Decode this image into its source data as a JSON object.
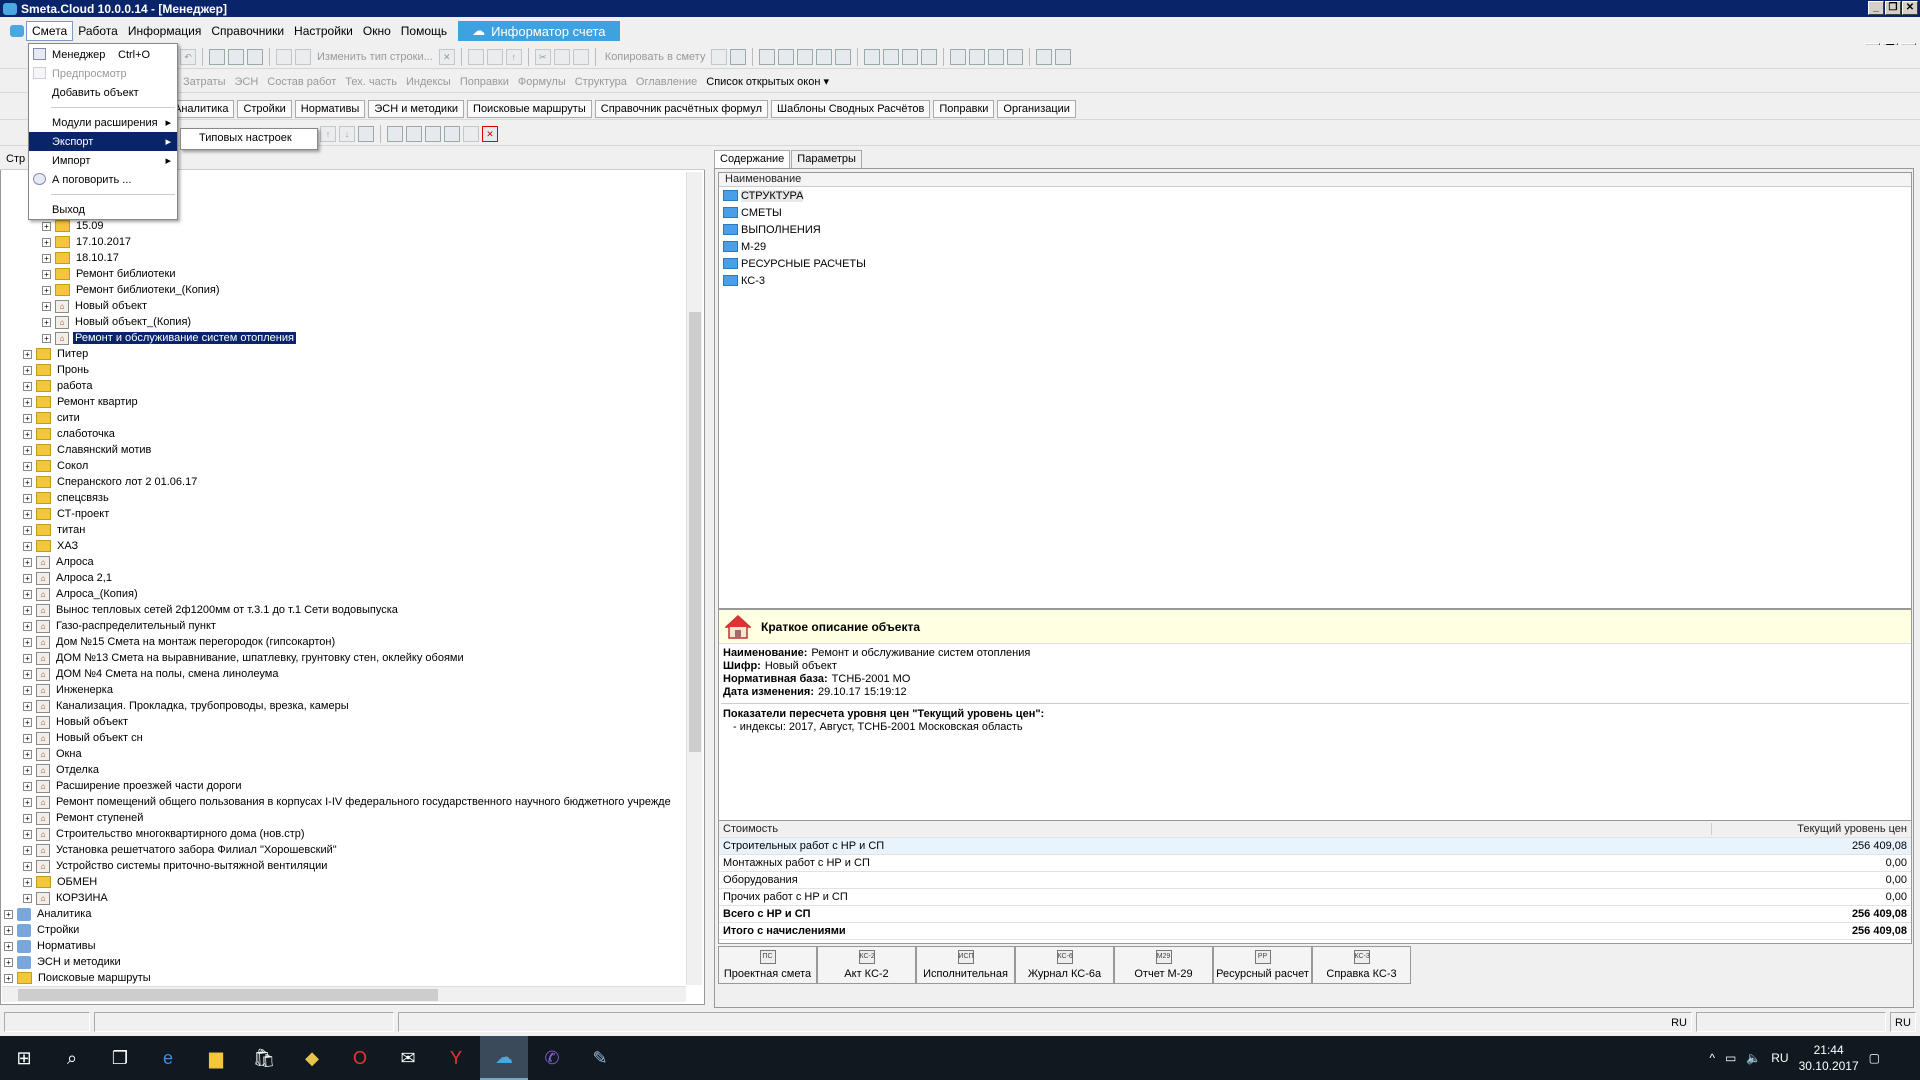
{
  "titlebar": {
    "title": "Smeta.Cloud  10.0.0.14  - [Менеджер]"
  },
  "menubar": {
    "items": [
      "Смета",
      "Работа",
      "Информация",
      "Справочники",
      "Настройки",
      "Окно",
      "Помощь"
    ],
    "informer": "Информатор счета"
  },
  "toolbar1": {
    "change_type": "Изменить тип строки...",
    "copy_to": "Копировать в смету"
  },
  "toolbar2": {
    "items": [
      "Затраты",
      "ЭСН",
      "Состав работ",
      "Тех. часть",
      "Индексы",
      "Поправки",
      "Формулы",
      "Структура",
      "Оглавление"
    ],
    "open_windows": "Список открытых окон"
  },
  "toolbar3": {
    "tabs": [
      "Аналитика",
      "Стройки",
      "Нормативы",
      "ЭСН и методики",
      "Поисковые маршруты",
      "Справочник расчётных формул",
      "Шаблоны Сводных Расчётов",
      "Поправки",
      "Организации"
    ]
  },
  "left_header": "Стр",
  "dropdown": {
    "manager": "Менеджер",
    "manager_shortcut": "Ctrl+O",
    "preview": "Предпросмотр",
    "add_object": "Добавить объект",
    "extensions": "Модули расширения",
    "export": "Экспорт",
    "import": "Импорт",
    "discuss": "А поговорить ...",
    "exit": "Выход"
  },
  "submenu": {
    "item": "Типовых настроек"
  },
  "tree": [
    {
      "label": "15.09",
      "icon": "folder",
      "level": 2
    },
    {
      "label": "17.10.2017",
      "icon": "folder",
      "level": 2
    },
    {
      "label": "18.10.17",
      "icon": "folder",
      "level": 2
    },
    {
      "label": "Ремонт библиотеки",
      "icon": "folder",
      "level": 2
    },
    {
      "label": "Ремонт библиотеки_(Копия)",
      "icon": "folder",
      "level": 2
    },
    {
      "label": "Новый объект",
      "icon": "object",
      "level": 2
    },
    {
      "label": "Новый объект_(Копия)",
      "icon": "object",
      "level": 2
    },
    {
      "label": "Ремонт и обслуживание систем отопления",
      "icon": "object",
      "level": 2,
      "selected": true
    },
    {
      "label": "Питер",
      "icon": "folder",
      "level": 1
    },
    {
      "label": "Пронь",
      "icon": "folder",
      "level": 1
    },
    {
      "label": "работа",
      "icon": "folder",
      "level": 1
    },
    {
      "label": "Ремонт квартир",
      "icon": "folder",
      "level": 1
    },
    {
      "label": "сити",
      "icon": "folder",
      "level": 1
    },
    {
      "label": "слаботочка",
      "icon": "folder",
      "level": 1
    },
    {
      "label": "Славянский мотив",
      "icon": "folder",
      "level": 1
    },
    {
      "label": "Сокол",
      "icon": "folder",
      "level": 1
    },
    {
      "label": "Сперанского лот 2 01.06.17",
      "icon": "folder",
      "level": 1
    },
    {
      "label": "спецсвязь",
      "icon": "folder",
      "level": 1
    },
    {
      "label": "СТ-проект",
      "icon": "folder",
      "level": 1
    },
    {
      "label": "титан",
      "icon": "folder",
      "level": 1
    },
    {
      "label": "ХАЗ",
      "icon": "folder",
      "level": 1
    },
    {
      "label": "Алроса",
      "icon": "object",
      "level": 1
    },
    {
      "label": "Алроса 2,1",
      "icon": "object",
      "level": 1
    },
    {
      "label": "Алроса_(Копия)",
      "icon": "object",
      "level": 1
    },
    {
      "label": "Вынос тепловых сетей 2ф1200мм от т.3.1 до т.1 Сети водовыпуска",
      "icon": "object",
      "level": 1
    },
    {
      "label": "Газо-распределительный пункт",
      "icon": "object",
      "level": 1
    },
    {
      "label": "Дом  №15 Смета на монтаж перегородок (гипсокартон)",
      "icon": "object",
      "level": 1
    },
    {
      "label": "ДОМ №13 Смета на выравнивание, шпатлевку, грунтовку стен, оклейку обоями",
      "icon": "object",
      "level": 1
    },
    {
      "label": "ДОМ №4 Смета на полы, смена линолеума",
      "icon": "object",
      "level": 1
    },
    {
      "label": "Инженерка",
      "icon": "object",
      "level": 1
    },
    {
      "label": "Канализация. Прокладка, трубопроводы, врезка, камеры",
      "icon": "object",
      "level": 1
    },
    {
      "label": "Новый объект",
      "icon": "object",
      "level": 1
    },
    {
      "label": "Новый объект сн",
      "icon": "object",
      "level": 1
    },
    {
      "label": "Окна",
      "icon": "object",
      "level": 1
    },
    {
      "label": "Отделка",
      "icon": "object",
      "level": 1
    },
    {
      "label": "Расширение проезжей части дороги",
      "icon": "object",
      "level": 1
    },
    {
      "label": "Ремонт помещений общего пользования в корпусах I-IV федерального государственного научного бюджетного учрежде",
      "icon": "object",
      "level": 1
    },
    {
      "label": "Ремонт ступеней",
      "icon": "object",
      "level": 1
    },
    {
      "label": "Строительство многоквартирного дома (нов.стр)",
      "icon": "object",
      "level": 1
    },
    {
      "label": "Установка решетчатого забора Филиал \"Хорошевский\"",
      "icon": "object",
      "level": 1
    },
    {
      "label": "Устройство системы приточно-вытяжной вентиляции",
      "icon": "object",
      "level": 1
    },
    {
      "label": "ОБМЕН",
      "icon": "folder",
      "level": 1
    },
    {
      "label": "КОРЗИНА",
      "icon": "object",
      "level": 1
    },
    {
      "label": "Аналитика",
      "icon": "node",
      "level": 0
    },
    {
      "label": "Стройки",
      "icon": "node",
      "level": 0
    },
    {
      "label": "Нормативы",
      "icon": "node",
      "level": 0
    },
    {
      "label": "ЭСН и методики",
      "icon": "node",
      "level": 0
    },
    {
      "label": "Поисковые маршруты",
      "icon": "folder",
      "level": 0
    }
  ],
  "right_tabs": [
    "Содержание",
    "Параметры"
  ],
  "content": {
    "header": "Наименование",
    "items": [
      "СТРУКТУРА",
      "СМЕТЫ",
      "ВЫПОЛНЕНИЯ",
      "М-29",
      "РЕСУРСНЫЕ РАСЧЕТЫ",
      "КС-3"
    ]
  },
  "description": {
    "title": "Краткое описание объекта",
    "lines": [
      {
        "label": "Наименование:",
        "value": "Ремонт и обслуживание систем отопления"
      },
      {
        "label": "Шифр:",
        "value": "Новый объект"
      },
      {
        "label": "Нормативная база:",
        "value": "ТСНБ-2001 МО"
      },
      {
        "label": "Дата изменения:",
        "value": "29.10.17 15:19:12"
      }
    ],
    "indicators_title": "Показатели пересчета уровня цен \"Текущий уровень цен\":",
    "indicators_line": "- индексы: 2017, Август, ТСНБ-2001 Московская область"
  },
  "costs": {
    "header_name": "Стоимость",
    "header_value": "Текущий уровень цен",
    "rows": [
      {
        "name": "Строительных работ с НР и СП",
        "value": "256 409,08"
      },
      {
        "name": "Монтажных работ с НР и СП",
        "value": "0,00"
      },
      {
        "name": "Оборудования",
        "value": "0,00"
      },
      {
        "name": "Прочих работ с НР и СП",
        "value": "0,00"
      }
    ],
    "total": {
      "name": "Всего с НР и СП",
      "value": "256 409,08"
    },
    "grand_total": {
      "name": "Итого с начислениями",
      "value": "256 409,08"
    }
  },
  "bottom_buttons": [
    "Проектная смета",
    "Акт КС-2",
    "Исполнительная",
    "Журнал КС-6а",
    "Отчет М-29",
    "Ресурсный расчет",
    "Справка КС-3"
  ],
  "bottom_icons": [
    "ПС",
    "КС-2",
    "ИСП",
    "КС-6",
    "М29",
    "РР",
    "КС-3"
  ],
  "statusbar": {
    "lang": "RU",
    "lang2": "RU"
  },
  "taskbar": {
    "time": "21:44",
    "date": "30.10.2017"
  }
}
